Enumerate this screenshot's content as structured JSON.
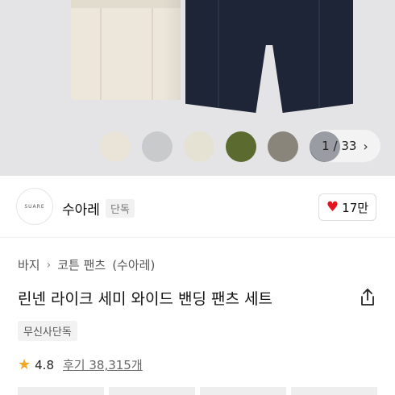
{
  "gallery": {
    "counter_current": "1",
    "counter_sep": "/",
    "counter_total": "33",
    "swatches": [
      {
        "name": "beige",
        "color": "#e9e4d7"
      },
      {
        "name": "light-gray",
        "color": "#c9cacc"
      },
      {
        "name": "ivory",
        "color": "#e6e2d3"
      },
      {
        "name": "olive",
        "color": "#5b6a2e"
      },
      {
        "name": "taupe",
        "color": "#8a857b"
      },
      {
        "name": "navy",
        "color": "#1d2434"
      }
    ],
    "next_icon": "chevron-right-icon"
  },
  "brand": {
    "logo_text": "SUARE",
    "name": "수아레",
    "badge": "단독",
    "likes": "17만",
    "like_icon": "heart-icon",
    "like_color": "#e8121c"
  },
  "breadcrumb": {
    "items": [
      "바지",
      "코튼 팬츠",
      "(수아레)"
    ],
    "separator": "›"
  },
  "product": {
    "title": "린넨 라이크 세미 와이드 밴딩 팬츠 세트",
    "tag": "무신사단독",
    "share_icon": "share-icon"
  },
  "rating": {
    "value": "4.8",
    "reviews_label": "후기 38,315개",
    "star_color": "#f5a623"
  }
}
